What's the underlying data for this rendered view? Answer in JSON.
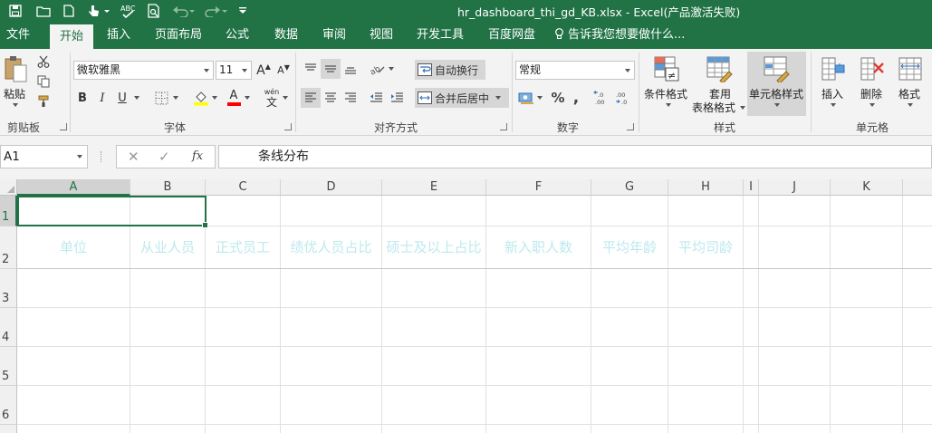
{
  "window": {
    "title": "hr_dashboard_thi_gd_KB.xlsx - Excel(产品激活失败)"
  },
  "tabs": [
    {
      "label": "文件"
    },
    {
      "label": "开始"
    },
    {
      "label": "插入"
    },
    {
      "label": "页面布局"
    },
    {
      "label": "公式"
    },
    {
      "label": "数据"
    },
    {
      "label": "审阅"
    },
    {
      "label": "视图"
    },
    {
      "label": "开发工具"
    },
    {
      "label": "百度网盘"
    }
  ],
  "tell_me": "告诉我您想要做什么...",
  "ribbon": {
    "clipboard": {
      "label": "剪贴板",
      "paste": "粘贴"
    },
    "font": {
      "label": "字体",
      "name": "微软雅黑",
      "size": "11",
      "bold": "B",
      "italic": "I",
      "underline": "U",
      "wen": "wén",
      "wen_char": "文",
      "grow": "A",
      "shrink": "A",
      "color_a": "A"
    },
    "align": {
      "label": "对齐方式",
      "wrap": "自动换行",
      "merge": "合并后居中"
    },
    "number": {
      "label": "数字",
      "format": "常规",
      "percent": "%",
      "comma": ","
    },
    "styles": {
      "label": "样式",
      "conditional": "条件格式",
      "table_line1": "套用",
      "table_line2": "表格格式",
      "cell_styles": "单元格样式"
    },
    "cells": {
      "label": "单元格",
      "insert": "插入",
      "delete": "删除",
      "format": "格式"
    }
  },
  "formula_bar": {
    "name_box": "A1",
    "cancel": "✕",
    "enter": "✓",
    "fx": "fx",
    "content": "条线分布"
  },
  "sheet": {
    "columns": [
      "A",
      "B",
      "C",
      "D",
      "E",
      "F",
      "G",
      "H",
      "I",
      "J",
      "K"
    ],
    "rows": [
      "1",
      "2",
      "3",
      "4",
      "5",
      "6"
    ],
    "headers": {
      "a2": "单位",
      "b2": "从业人员",
      "c2": "正式员工",
      "d2": "绩优人员占比",
      "e2": "硕士及以上占比",
      "f2": "新入职人数",
      "g2": "平均年龄",
      "h2": "平均司龄"
    },
    "cell_text_color": "#bde9ee",
    "accent": "#217346"
  }
}
